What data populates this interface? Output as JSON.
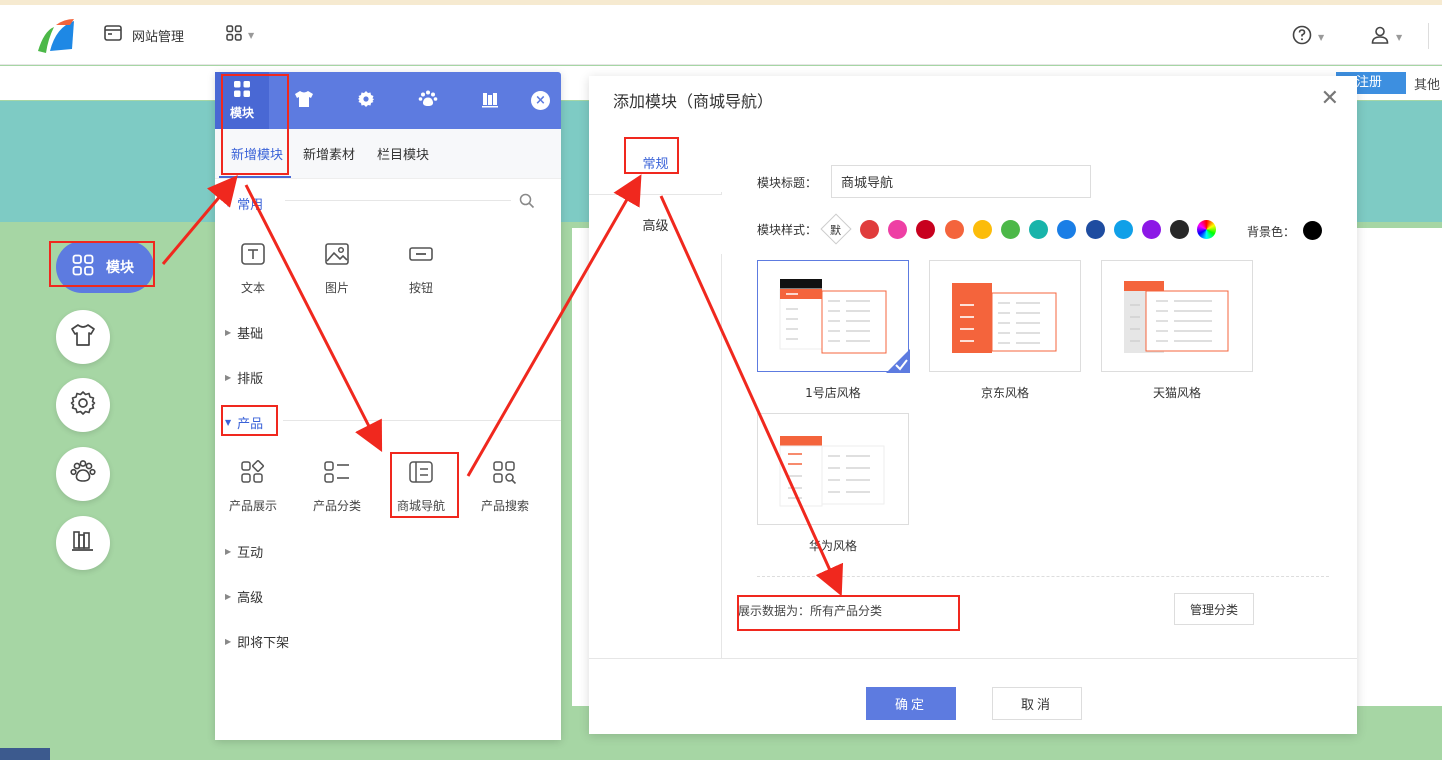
{
  "topbar": {
    "site_mgmt_label": "网站管理",
    "icons": [
      "logo-sail-icon",
      "window-icon",
      "grid-apps-icon",
      "help-circle-icon",
      "user-icon"
    ]
  },
  "subbar": {
    "register_label": "注册",
    "other_label": "其他"
  },
  "dock": {
    "active_label": "模块",
    "items": [
      "grid-icon",
      "shirt-icon",
      "gear-icon",
      "paw-icon",
      "books-icon"
    ]
  },
  "panel": {
    "tabs": [
      {
        "label": "模块",
        "icon": "grid-icon"
      },
      {
        "label": "",
        "icon": "shirt-icon"
      },
      {
        "label": "",
        "icon": "gear-icon"
      },
      {
        "label": "",
        "icon": "paw-icon"
      },
      {
        "label": "",
        "icon": "books-icon"
      }
    ],
    "subtabs": [
      "新增模块",
      "新增素材",
      "栏目模块"
    ],
    "sections": {
      "common": "常用",
      "basic": "基础",
      "layout": "排版",
      "product": "产品",
      "interactive": "互动",
      "advanced": "高级",
      "retiring": "即将下架"
    },
    "common_items": [
      "文本",
      "图片",
      "按钮"
    ],
    "product_items": [
      "产品展示",
      "产品分类",
      "商城导航",
      "产品搜索"
    ]
  },
  "dialog": {
    "title": "添加模块（商城导航）",
    "tabs": [
      "常规",
      "高级"
    ],
    "module_title_label": "模块标题：",
    "module_title_value": "商城导航",
    "module_style_label": "模块样式：",
    "default_swatch_label": "默",
    "swatch_colors": [
      "#e03c3c",
      "#ee3fa4",
      "#c8001e",
      "#f4643c",
      "#fcbc0a",
      "#4cb848",
      "#18b4aa",
      "#1a7ee6",
      "#1e4ca0",
      "#10a0e8",
      "#8c18e6",
      "#282828"
    ],
    "bg_color_label": "背景色：",
    "bg_color": "#000000",
    "styles": [
      "1号店风格",
      "京东风格",
      "天猫风格",
      "华为风格"
    ],
    "selected_style": "1号店风格",
    "data_source": "展示数据为：所有产品分类",
    "manage_btn": "管理分类",
    "ok_btn": "确定",
    "cancel_btn": "取消"
  },
  "colors": {
    "accent": "#5d7be0",
    "annotation_red": "#f0281e",
    "banner": "#7ecbc4",
    "page_bg": "#a6d6a4"
  }
}
